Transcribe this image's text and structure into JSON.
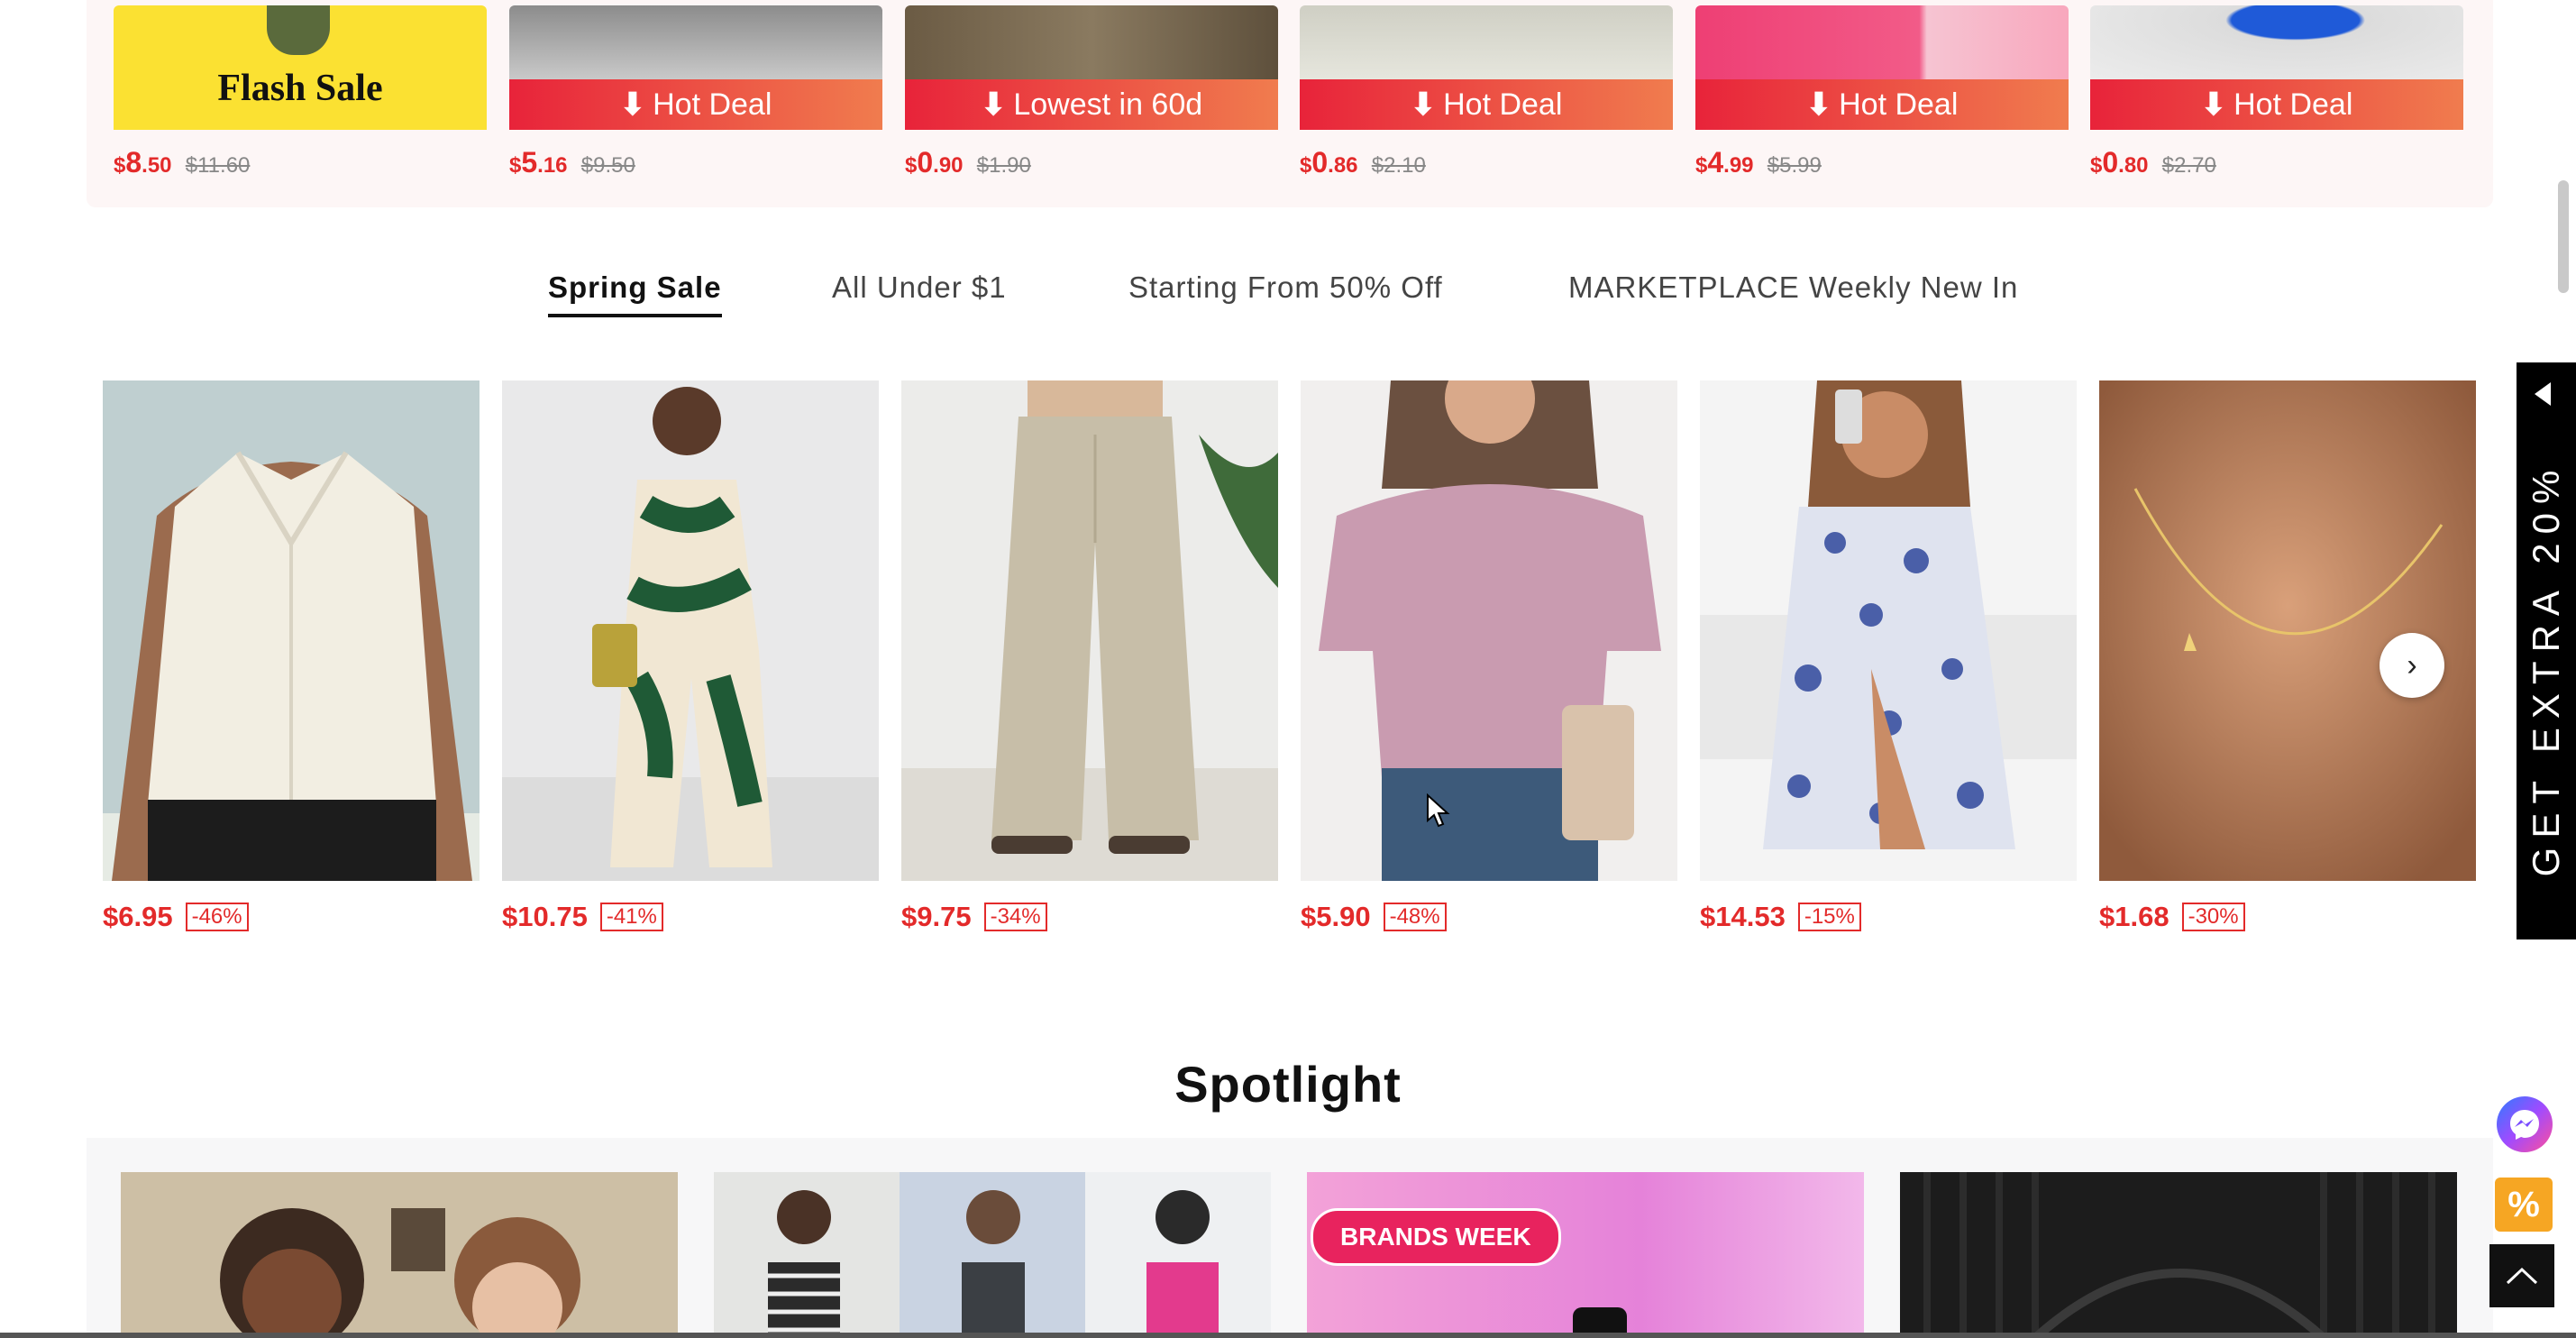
{
  "flash_deals": [
    {
      "label": "Flash Sale",
      "price_int": "8",
      "price_dec": ".50",
      "old": "$11.60"
    },
    {
      "label": "Hot Deal",
      "price_int": "5",
      "price_dec": ".16",
      "old": "$9.50"
    },
    {
      "label": "Lowest in 60d",
      "price_int": "0",
      "price_dec": ".90",
      "old": "$1.90"
    },
    {
      "label": "Hot Deal",
      "price_int": "0",
      "price_dec": ".86",
      "old": "$2.10"
    },
    {
      "label": "Hot Deal",
      "price_int": "4",
      "price_dec": ".99",
      "old": "$5.99"
    },
    {
      "label": "Hot Deal",
      "price_int": "0",
      "price_dec": ".80",
      "old": "$2.70"
    }
  ],
  "currency": "$",
  "tabs": [
    "Spring Sale",
    "All Under $1",
    "Starting From 50% Off",
    "MARKETPLACE Weekly New In"
  ],
  "products": [
    {
      "price": "$6.95",
      "discount": "-46%"
    },
    {
      "price": "$10.75",
      "discount": "-41%"
    },
    {
      "price": "$9.75",
      "discount": "-34%"
    },
    {
      "price": "$5.90",
      "discount": "-48%"
    },
    {
      "price": "$14.53",
      "discount": "-15%"
    },
    {
      "price": "$1.68",
      "discount": "-30%"
    }
  ],
  "side_promo": "GET EXTRA 20%",
  "spotlight": {
    "title": "Spotlight",
    "badge": "BRANDS WEEK"
  },
  "colors": {
    "accent": "#e32a2a",
    "banner_start": "#e8233a",
    "banner_end": "#f07c4e",
    "flash_yellow": "#fbe132"
  },
  "icons": {
    "next": "chevron-right-icon",
    "messenger": "messenger-icon",
    "coupon": "percent-icon",
    "top": "chevron-up-icon",
    "promo": "caret-left-icon"
  }
}
